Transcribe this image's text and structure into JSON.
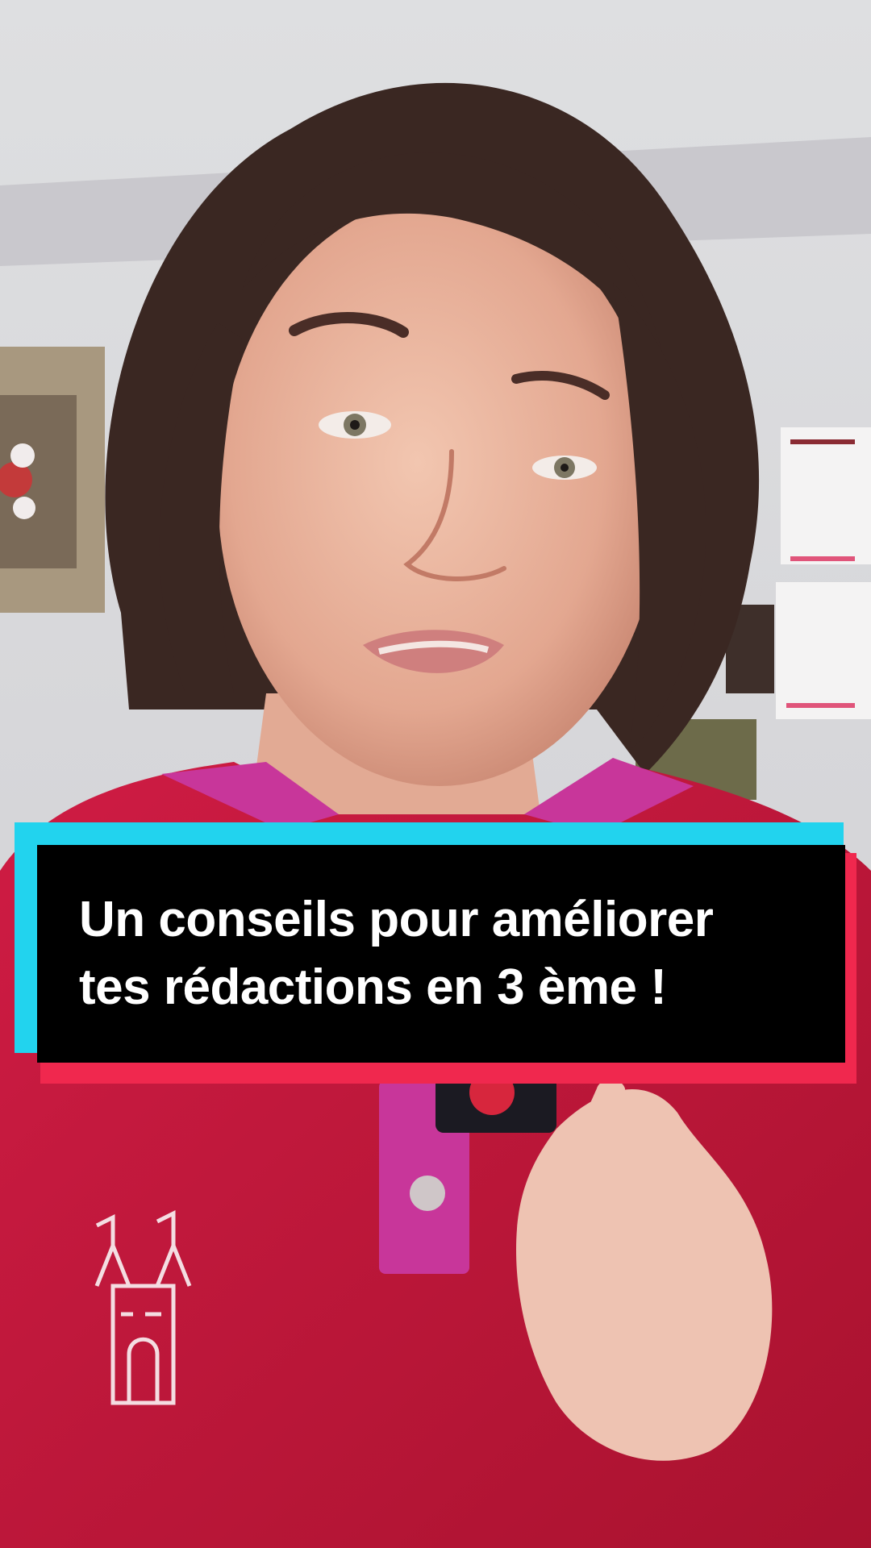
{
  "video": {
    "caption": {
      "line1": "Un conseils pour améliorer",
      "line2": "tes rédactions en 3 ème !"
    }
  },
  "colors": {
    "caption_bg": "#000000",
    "caption_text": "#ffffff",
    "accent_cyan": "#22d3ee",
    "accent_red": "#f0284e",
    "sweater": "#c0173a",
    "collar": "#c8369a",
    "wall": "#d9d8dc"
  }
}
